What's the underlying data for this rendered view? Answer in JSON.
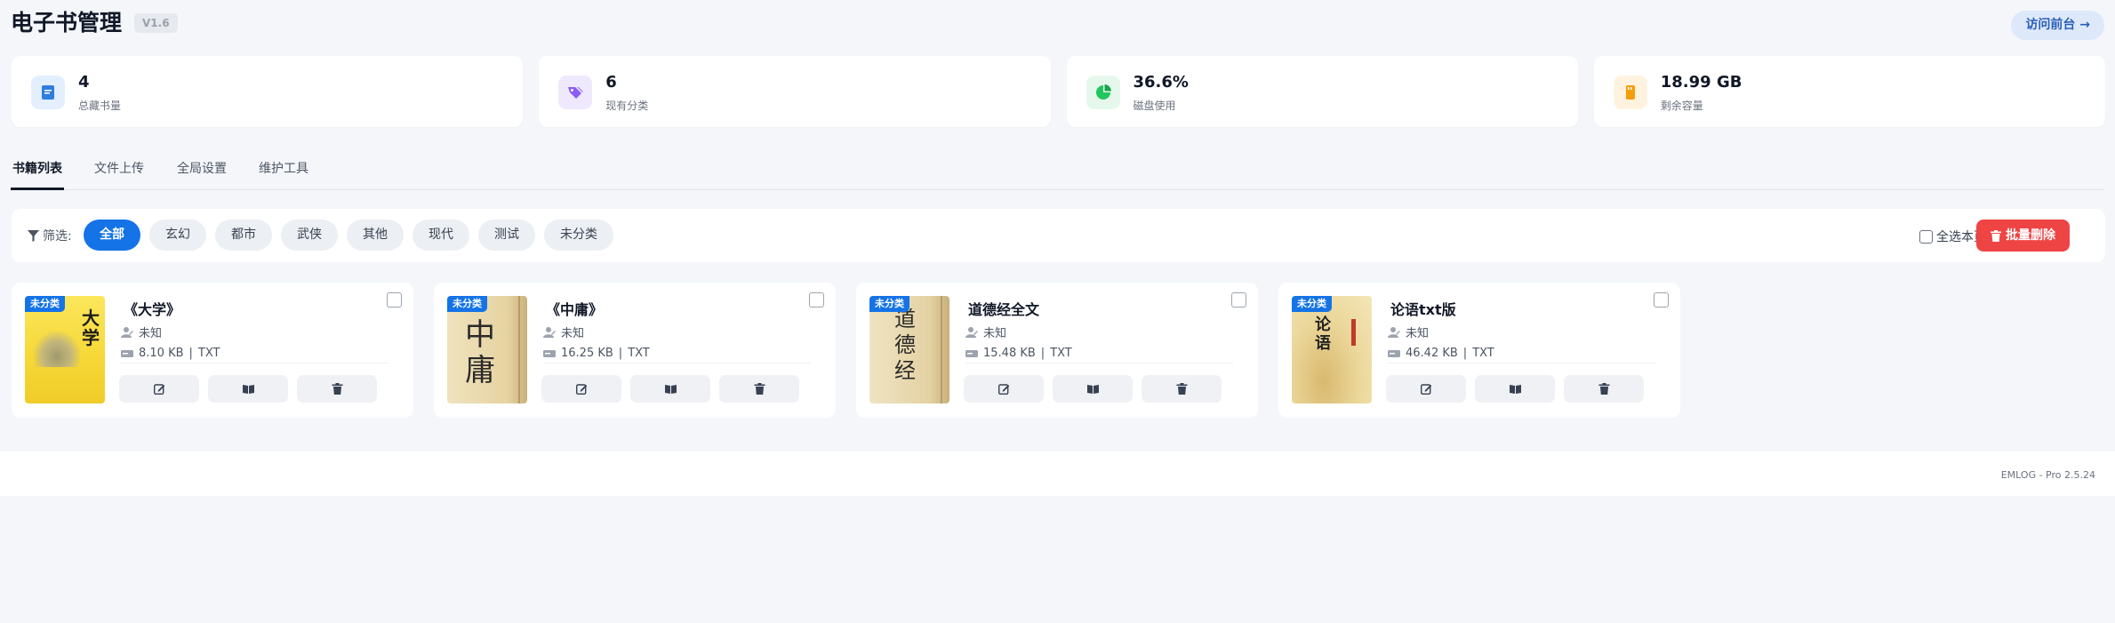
{
  "header": {
    "title": "电子书管理",
    "version": "V1.6",
    "visit_label": "访问前台 →"
  },
  "stats": [
    {
      "value": "4",
      "label": "总藏书量",
      "icon": "book-icon",
      "color": "#2f7de1",
      "bg": "#e3efff"
    },
    {
      "value": "6",
      "label": "现有分类",
      "icon": "tags-icon",
      "color": "#8b5cf6",
      "bg": "#efe9ff"
    },
    {
      "value": "36.6%",
      "label": "磁盘使用",
      "icon": "pie-chart-icon",
      "color": "#22c55e",
      "bg": "#e6f8ec"
    },
    {
      "value": "18.99 GB",
      "label": "剩余容量",
      "icon": "storage-icon",
      "color": "#f59e0b",
      "bg": "#fff3df"
    }
  ],
  "tabs": [
    "书籍列表",
    "文件上传",
    "全局设置",
    "维护工具"
  ],
  "filter": {
    "label": "筛选:",
    "chips": [
      "全部",
      "玄幻",
      "都市",
      "武侠",
      "其他",
      "现代",
      "测试",
      "未分类"
    ],
    "select_all_label": "全选本页",
    "bulk_delete_label": "批量删除"
  },
  "books": [
    {
      "title": "《大学》",
      "author": "未知",
      "size": "8.10 KB",
      "format": "TXT",
      "badge": "未分类",
      "cover_text": "大学"
    },
    {
      "title": "《中庸》",
      "author": "未知",
      "size": "16.25 KB",
      "format": "TXT",
      "badge": "未分类",
      "cover_text": "中庸"
    },
    {
      "title": "道德经全文",
      "author": "未知",
      "size": "15.48 KB",
      "format": "TXT",
      "badge": "未分类",
      "cover_text": "道德经"
    },
    {
      "title": "论语txt版",
      "author": "未知",
      "size": "46.42 KB",
      "format": "TXT",
      "badge": "未分类",
      "cover_text": "论语"
    }
  ],
  "meta_separator": "|",
  "footer": {
    "text": "EMLOG - Pro 2.5.24"
  }
}
